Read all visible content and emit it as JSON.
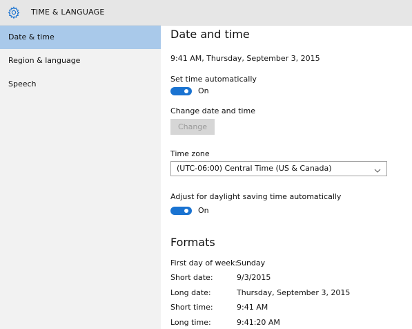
{
  "header": {
    "title": "TIME & LANGUAGE",
    "icon": "gear-icon"
  },
  "sidebar": {
    "items": [
      {
        "label": "Date & time",
        "selected": true
      },
      {
        "label": "Region & language",
        "selected": false
      },
      {
        "label": "Speech",
        "selected": false
      }
    ]
  },
  "main": {
    "title": "Date and time",
    "current_datetime": "9:41 AM, Thursday, September 3, 2015",
    "set_time_auto_label": "Set time automatically",
    "set_time_auto_state": "On",
    "change_label": "Change date and time",
    "change_button": "Change",
    "timezone_label": "Time zone",
    "timezone_value": "(UTC-06:00) Central Time (US & Canada)",
    "dst_label": "Adjust for daylight saving time automatically",
    "dst_state": "On",
    "formats_title": "Formats",
    "formats": [
      {
        "label": "First day of week:",
        "value": "Sunday"
      },
      {
        "label": "Short date:",
        "value": "9/3/2015"
      },
      {
        "label": "Long date:",
        "value": "Thursday, September 3, 2015"
      },
      {
        "label": "Short time:",
        "value": "9:41 AM"
      },
      {
        "label": "Long time:",
        "value": "9:41:20 AM"
      }
    ]
  },
  "colors": {
    "accent": "#1a73d1",
    "selected_nav": "#a9c9ea",
    "sidebar_bg": "#f2f2f2",
    "header_bg": "#e6e6e6"
  }
}
